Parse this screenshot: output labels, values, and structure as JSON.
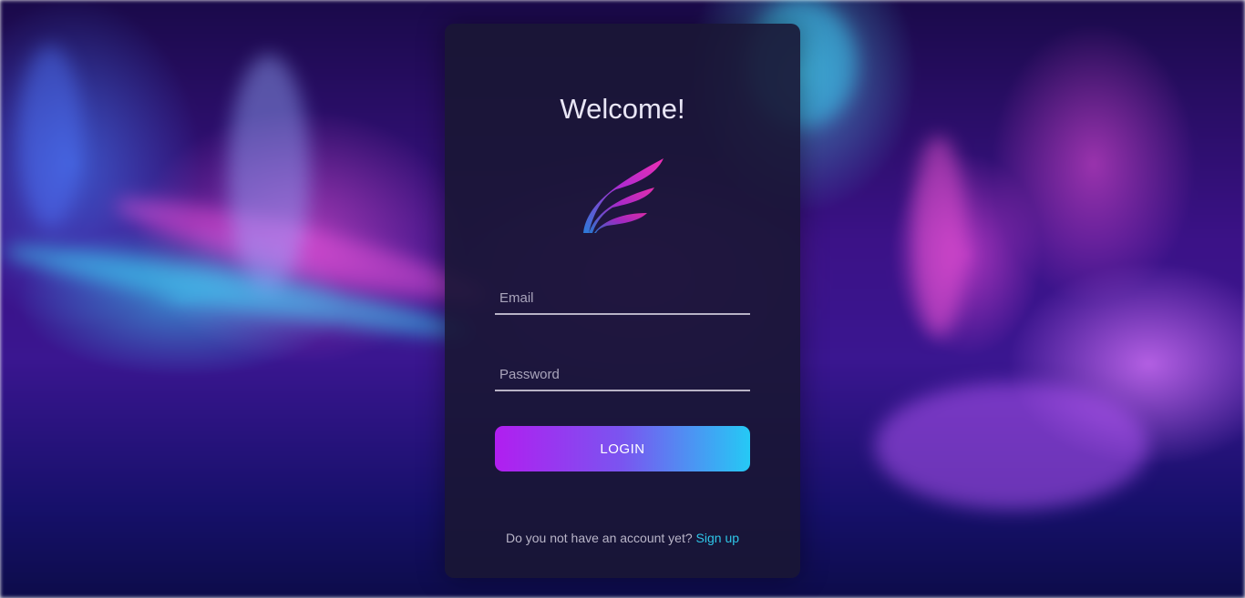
{
  "login": {
    "title": "Welcome!",
    "email_placeholder": "Email",
    "password_placeholder": "Password",
    "login_label": "LOGIN",
    "signup_prompt": "Do you not have an account yet?",
    "signup_link": "Sign up"
  },
  "logo": {
    "icon": "wing-logo",
    "gradient_start": "#2a7bd8",
    "gradient_end": "#ee2fb3"
  },
  "colors": {
    "accent_start": "#b11ef0",
    "accent_end": "#25c9f5",
    "link": "#2ec6e8",
    "card": "#1a1634"
  }
}
